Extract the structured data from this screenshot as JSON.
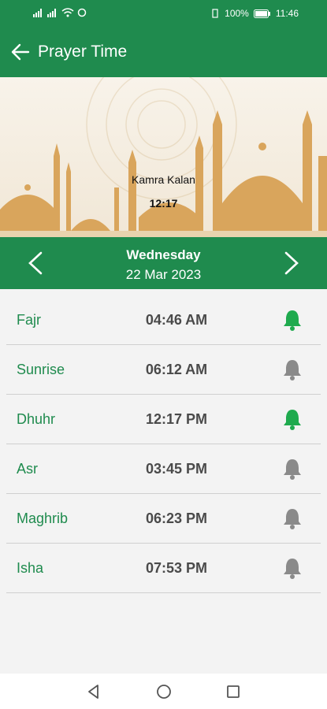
{
  "status": {
    "battery": "100%",
    "time": "11:46"
  },
  "header": {
    "title": "Prayer Time"
  },
  "banner": {
    "location": "Kamra Kalan",
    "clock": "12:17"
  },
  "date_nav": {
    "day": "Wednesday",
    "date": "22 Mar 2023"
  },
  "prayers": [
    {
      "name": "Fajr",
      "time": "04:46 AM",
      "alarm_on": true
    },
    {
      "name": "Sunrise",
      "time": "06:12 AM",
      "alarm_on": false
    },
    {
      "name": "Dhuhr",
      "time": "12:17 PM",
      "alarm_on": true
    },
    {
      "name": "Asr",
      "time": "03:45 PM",
      "alarm_on": false
    },
    {
      "name": "Maghrib",
      "time": "06:23 PM",
      "alarm_on": false
    },
    {
      "name": "Isha",
      "time": "07:53 PM",
      "alarm_on": false
    }
  ],
  "colors": {
    "primary": "#1f8b4e",
    "bell_on": "#1faa4e",
    "bell_off": "#8a8a8a",
    "mosque": "#d9a55c"
  }
}
